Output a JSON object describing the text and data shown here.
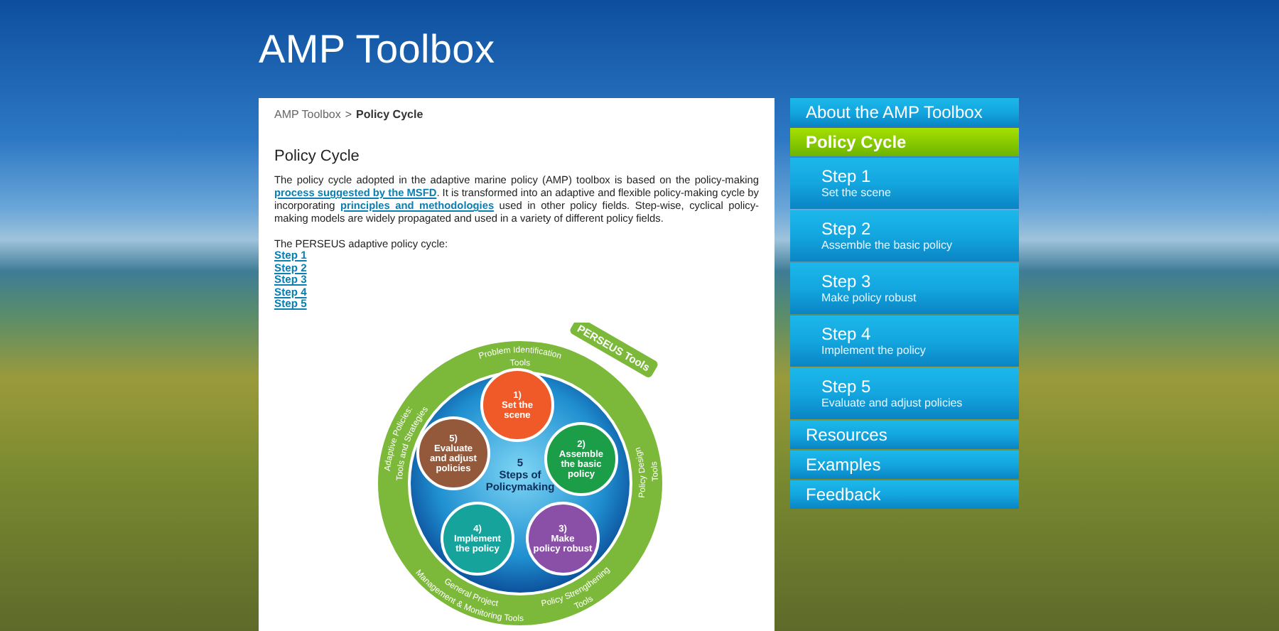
{
  "header": {
    "title": "AMP Toolbox"
  },
  "breadcrumb": {
    "items": [
      {
        "label": "AMP Toolbox",
        "current": false
      },
      {
        "label": "Policy Cycle",
        "current": true
      }
    ],
    "separator": ">"
  },
  "content": {
    "heading": "Policy Cycle",
    "paragraph": [
      {
        "text": "The policy cycle adopted in the adaptive marine policy (AMP) toolbox is based on the policy-making ",
        "link": false
      },
      {
        "text": "process suggested by the MSFD",
        "link": true
      },
      {
        "text": ". It is transformed into an adaptive and flexible policy-making cycle by incorporating ",
        "link": false
      },
      {
        "text": "principles and methodologies",
        "link": true
      },
      {
        "text": " used in other policy fields. Step-wise, cyclical policy-making models are widely propagated and used in a variety of different policy fields.",
        "link": false
      }
    ],
    "intro": "The PERSEUS adaptive policy cycle:",
    "step_links": [
      "Step 1",
      "Step 2",
      "Step 3",
      "Step 4",
      "Step 5"
    ]
  },
  "diagram": {
    "center": [
      "5",
      "Steps of",
      "Policymaking"
    ],
    "badge": "PERSEUS Tools",
    "steps": [
      {
        "number": "1)",
        "lines": [
          "Set the",
          "scene"
        ],
        "color": "#f05a28"
      },
      {
        "number": "5)",
        "lines": [
          "Evaluate",
          "and adjust",
          "policies"
        ],
        "color": "#94583a"
      },
      {
        "number": "2)",
        "lines": [
          "Assemble",
          "the basic",
          "policy"
        ],
        "color": "#1c9e48"
      },
      {
        "number": "4)",
        "lines": [
          "Implement",
          "the policy"
        ],
        "color": "#16a39b"
      },
      {
        "number": "3)",
        "lines": [
          "Make",
          "policy robust"
        ],
        "color": "#8a4fa6"
      }
    ],
    "ring_labels": [
      {
        "lines": [
          "Problem Identification",
          "Tools"
        ]
      },
      {
        "lines": [
          "Adaptive Policies:",
          "Tools and Strategies"
        ]
      },
      {
        "lines": [
          "Policy Design",
          "Tools"
        ]
      },
      {
        "lines": [
          "General Project",
          "Management & Monitoring Tools"
        ]
      },
      {
        "lines": [
          "Policy Strengthening",
          "Tools"
        ]
      }
    ]
  },
  "sidebar": {
    "items": [
      {
        "kind": "section",
        "label": "About the AMP Toolbox",
        "selected": false
      },
      {
        "kind": "section",
        "label": "Policy Cycle",
        "selected": true
      },
      {
        "kind": "step",
        "label": "Step 1",
        "subtitle": "Set the scene",
        "selected": false
      },
      {
        "kind": "step",
        "label": "Step 2",
        "subtitle": "Assemble the basic policy",
        "selected": false
      },
      {
        "kind": "step",
        "label": "Step 3",
        "subtitle": "Make policy robust",
        "selected": false
      },
      {
        "kind": "step",
        "label": "Step 4",
        "subtitle": "Implement the policy",
        "selected": false
      },
      {
        "kind": "step",
        "label": "Step 5",
        "subtitle": "Evaluate and adjust policies",
        "selected": false
      },
      {
        "kind": "section",
        "label": "Resources",
        "selected": false
      },
      {
        "kind": "section",
        "label": "Examples",
        "selected": false
      },
      {
        "kind": "section",
        "label": "Feedback",
        "selected": false
      }
    ]
  }
}
